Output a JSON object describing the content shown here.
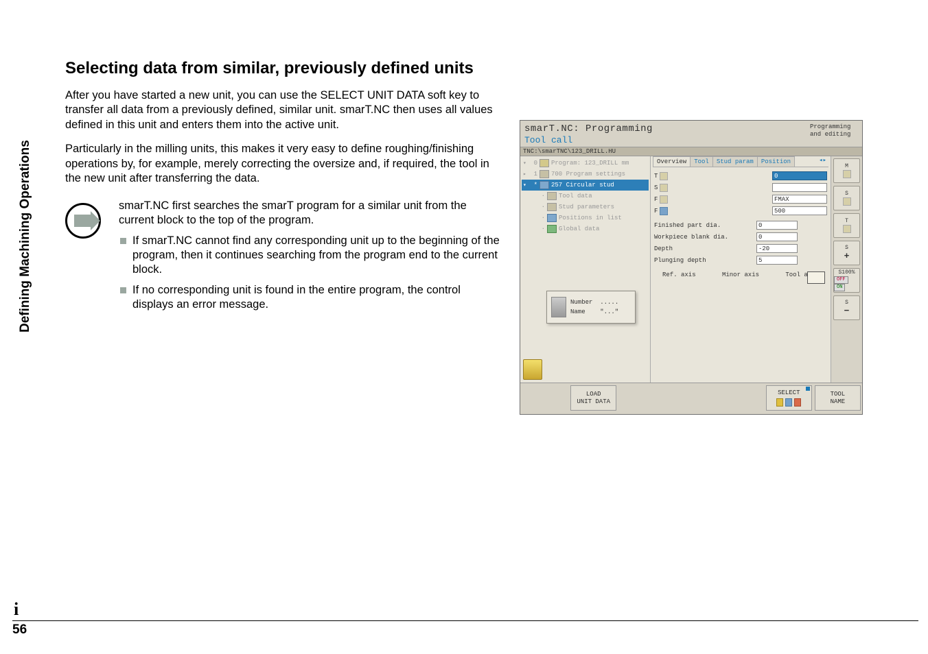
{
  "sidebar_label": "Defining Machining Operations",
  "page_number": "56",
  "heading": "Selecting data from similar, previously defined units",
  "para1": "After you have started a new unit, you can use the SELECT UNIT DATA soft key to transfer all data from a previously defined, similar unit. smarT.NC then uses all values defined in this unit and enters them into the active unit.",
  "para2": "Particularly in the milling units, this makes it very easy to define roughing/finishing operations by, for example, merely correcting the oversize and, if required, the tool in the new unit after transferring the data.",
  "note_intro": "smarT.NC first searches the smarT program for a similar unit from the current block to the top of the program.",
  "bullets": [
    "If smarT.NC cannot find any corresponding unit up to the beginning of the program, then it continues searching from the program end to the current block.",
    "If no corresponding unit is found in the entire program, the control displays an error message."
  ],
  "screenshot": {
    "title_main": "smarT.NC: Programming",
    "title_sub": "Tool call",
    "title_right_l1": "Programming",
    "title_right_l2": "and editing",
    "path": "TNC:\\smarTNC\\123_DRILL.HU",
    "tree": [
      {
        "caret": "▾",
        "num": "0",
        "label": "Program: 123_DRILL mm"
      },
      {
        "caret": "▸",
        "num": "1",
        "label": "700 Program settings"
      },
      {
        "caret": "▾",
        "num": "*",
        "label": "257 Circular stud",
        "active": true
      },
      {
        "caret": "",
        "num": "·",
        "label": "Tool data"
      },
      {
        "caret": "",
        "num": "·",
        "label": "Stud parameters"
      },
      {
        "caret": "",
        "num": "·",
        "label": "Positions in list"
      },
      {
        "caret": "",
        "num": "·",
        "label": "Global data"
      }
    ],
    "popup": {
      "l1": "Number",
      "v1": ".....",
      "l2": "Name",
      "v2": "\"...\""
    },
    "tabs": [
      "Overview",
      "Tool",
      "Stud param",
      "Position"
    ],
    "form": {
      "t_label": "T",
      "t_value": "0",
      "s_label": "S",
      "f_label": "F",
      "f_value": "FMAX",
      "f2_label": "F",
      "f2_value": "500",
      "r1_label": "Finished part dia.",
      "r1_value": "0",
      "r2_label": "Workpiece blank dia.",
      "r2_value": "0",
      "r3_label": "Depth",
      "r3_value": "-20",
      "r4_label": "Plunging depth",
      "r4_value": "5",
      "ax1": "Ref. axis",
      "ax2": "Minor axis",
      "ax3": "Tool axis"
    },
    "right_buttons": {
      "b1": "M",
      "b2": "S",
      "b3": "T",
      "b4_top": "S",
      "b4_sym": "+",
      "b5_top": "S100%",
      "b5_off": "OFF",
      "b5_on": "ON",
      "b6_top": "S",
      "b6_sym": "−"
    },
    "softkeys": {
      "k2_l1": "LOAD",
      "k2_l2": "UNIT DATA",
      "k6_l1": "SELECT",
      "k7_l1": "TOOL",
      "k7_l2": "NAME"
    }
  }
}
